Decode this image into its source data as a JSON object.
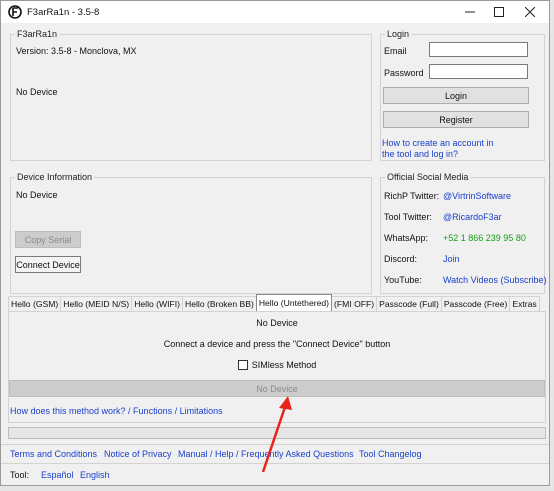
{
  "window": {
    "title": "F3arRa1n - 3.5-8"
  },
  "main_group": {
    "title": "F3arRa1n",
    "version": "Version: 3.5-8 - Monclova, MX",
    "status": "No Device"
  },
  "login": {
    "title": "Login",
    "email_label": "Email",
    "email_value": "",
    "password_label": "Password",
    "password_value": "",
    "login_button": "Login",
    "register_button": "Register",
    "help_link_line1": "How to create an account in",
    "help_link_line2": "the tool and log in?"
  },
  "device_info": {
    "title": "Device Information",
    "status": "No Device",
    "copy_serial": "Copy Serial",
    "connect_device": "Connect Device"
  },
  "social": {
    "title": "Official Social Media",
    "rows": [
      {
        "label": "RichP Twitter:",
        "value": "@VirtrinSoftware"
      },
      {
        "label": "Tool Twitter:",
        "value": "@RicardoF3ar"
      },
      {
        "label": "WhatsApp:",
        "value": "+52 1 866 239 95 80"
      },
      {
        "label": "Discord:",
        "value": "Join"
      },
      {
        "label": "YouTube:",
        "value": "Watch Videos (Subscribe)"
      }
    ]
  },
  "tabs": [
    "Hello (GSM)",
    "Hello (MEID N/S)",
    "Hello (WIFI)",
    "Hello (Broken BB)",
    "Hello (Untethered)",
    "(FMI OFF)",
    "Passcode (Full)",
    "Passcode (Free)",
    "Extras"
  ],
  "tab_panel": {
    "status": "No Device",
    "instruction": "Connect a device and press the \"Connect Device\" button",
    "simless_label": "SIMless Method",
    "action_button": "No Device",
    "method_link": "How does this method work? / Functions / Limitations"
  },
  "footer": {
    "links": [
      "Terms and Conditions",
      "Notice of Privacy",
      "Manual / Help / Frequently Asked Questions",
      "Tool Changelog"
    ],
    "tool_label": "Tool:",
    "languages": [
      "Español",
      "English"
    ]
  },
  "colors": {
    "link": "#1a3fcc",
    "whatsapp": "#12a312",
    "annotation_arrow": "#e8231c"
  }
}
